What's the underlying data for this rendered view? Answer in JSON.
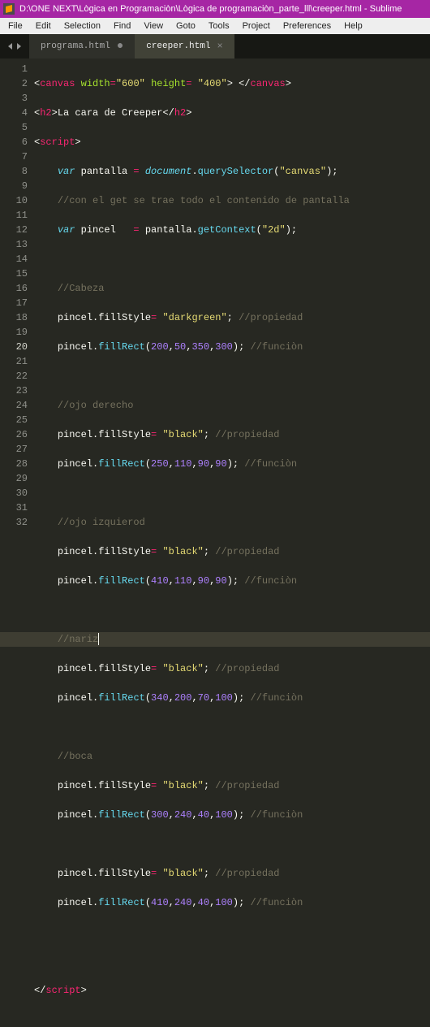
{
  "title": "D:\\ONE NEXT\\Lògica en Programaciòn\\Lògica de programaciòn_parte_lll\\creeper.html - Sublime",
  "menu": [
    "File",
    "Edit",
    "Selection",
    "Find",
    "View",
    "Goto",
    "Tools",
    "Project",
    "Preferences",
    "Help"
  ],
  "tabs": [
    {
      "label": "programa.html",
      "active": false,
      "dirty": true
    },
    {
      "label": "creeper.html",
      "active": true,
      "dirty": false
    }
  ],
  "cursor_line": 20,
  "code": {
    "l1": {
      "pre": "<",
      "tag": "canvas",
      "sp": " ",
      "a1": "width",
      "eq": "=",
      "v1": "\"600\"",
      "sp2": " ",
      "a2": "height",
      "eq2": "= ",
      "v2": "\"400\"",
      "gt": "> </",
      "tag2": "canvas",
      "end": ">"
    },
    "l2": {
      "pre": "<",
      "tag": "h2",
      "gt": ">",
      "txt": "La cara de Creeper",
      "lt": "</",
      "tag2": "h2",
      "end": ">"
    },
    "l3": {
      "pre": "<",
      "tag": "script",
      "end": ">"
    },
    "l4": {
      "ind": "    ",
      "kw": "var",
      "sp": " ",
      "name": "pantalla",
      "eq": " = ",
      "obj": "document",
      "dot": ".",
      "fn": "querySelector",
      "lp": "(",
      "arg": "\"canvas\"",
      "rp": ");"
    },
    "l5": {
      "ind": "    ",
      "comment": "//con el get se trae todo el contenido de pantalla"
    },
    "l6": {
      "ind": "    ",
      "kw": "var",
      "sp": " ",
      "name": "pincel  ",
      "eq": " = ",
      "obj2": "pantalla",
      "dot": ".",
      "fn": "getContext",
      "lp": "(",
      "arg": "\"2d\"",
      "rp": ");"
    },
    "l8": {
      "ind": "    ",
      "comment": "//Cabeza"
    },
    "l9": {
      "ind": "    ",
      "obj": "pincel",
      "dot": ".",
      "prop": "fillStyle",
      "eq": "= ",
      "val": "\"darkgreen\"",
      "semi": "; ",
      "comment": "//propiedad"
    },
    "l10": {
      "ind": "    ",
      "obj": "pincel",
      "dot": ".",
      "fn": "fillRect",
      "lp": "(",
      "a": "200",
      "c": ",",
      "b": "50",
      "c2": ",",
      "d": "350",
      "c3": ",",
      "e": "300",
      "rp": "); ",
      "comment": "//funciòn"
    },
    "l12": {
      "ind": "    ",
      "comment": "//ojo derecho"
    },
    "l13": {
      "ind": "    ",
      "obj": "pincel",
      "dot": ".",
      "prop": "fillStyle",
      "eq": "= ",
      "val": "\"black\"",
      "semi": "; ",
      "comment": "//propiedad"
    },
    "l14": {
      "ind": "    ",
      "obj": "pincel",
      "dot": ".",
      "fn": "fillRect",
      "lp": "(",
      "a": "250",
      "c": ",",
      "b": "110",
      "c2": ",",
      "d": "90",
      "c3": ",",
      "e": "90",
      "rp": "); ",
      "comment": "//funciòn"
    },
    "l16": {
      "ind": "    ",
      "comment": "//ojo izquierod"
    },
    "l17": {
      "ind": "    ",
      "obj": "pincel",
      "dot": ".",
      "prop": "fillStyle",
      "eq": "= ",
      "val": "\"black\"",
      "semi": "; ",
      "comment": "//propiedad"
    },
    "l18": {
      "ind": "    ",
      "obj": "pincel",
      "dot": ".",
      "fn": "fillRect",
      "lp": "(",
      "a": "410",
      "c": ",",
      "b": "110",
      "c2": ",",
      "d": "90",
      "c3": ",",
      "e": "90",
      "rp": "); ",
      "comment": "//funciòn"
    },
    "l20": {
      "ind": "    ",
      "comment": "//nariz"
    },
    "l21": {
      "ind": "    ",
      "obj": "pincel",
      "dot": ".",
      "prop": "fillStyle",
      "eq": "= ",
      "val": "\"black\"",
      "semi": "; ",
      "comment": "//propiedad"
    },
    "l22": {
      "ind": "    ",
      "obj": "pincel",
      "dot": ".",
      "fn": "fillRect",
      "lp": "(",
      "a": "340",
      "c": ",",
      "b": "200",
      "c2": ",",
      "d": "70",
      "c3": ",",
      "e": "100",
      "rp": "); ",
      "comment": "//funciòn"
    },
    "l24": {
      "ind": "    ",
      "comment": "//boca"
    },
    "l25": {
      "ind": "    ",
      "obj": "pincel",
      "dot": ".",
      "prop": "fillStyle",
      "eq": "= ",
      "val": "\"black\"",
      "semi": "; ",
      "comment": "//propiedad"
    },
    "l26": {
      "ind": "    ",
      "obj": "pincel",
      "dot": ".",
      "fn": "fillRect",
      "lp": "(",
      "a": "300",
      "c": ",",
      "b": "240",
      "c2": ",",
      "d": "40",
      "c3": ",",
      "e": "100",
      "rp": "); ",
      "comment": "//funciòn"
    },
    "l28": {
      "ind": "    ",
      "obj": "pincel",
      "dot": ".",
      "prop": "fillStyle",
      "eq": "= ",
      "val": "\"black\"",
      "semi": "; ",
      "comment": "//propiedad"
    },
    "l29": {
      "ind": "    ",
      "obj": "pincel",
      "dot": ".",
      "fn": "fillRect",
      "lp": "(",
      "a": "410",
      "c": ",",
      "b": "240",
      "c2": ",",
      "d": "40",
      "c3": ",",
      "e": "100",
      "rp": "); ",
      "comment": "//funciòn"
    },
    "l32": {
      "pre": "</",
      "tag": "script",
      "end": ">"
    }
  }
}
